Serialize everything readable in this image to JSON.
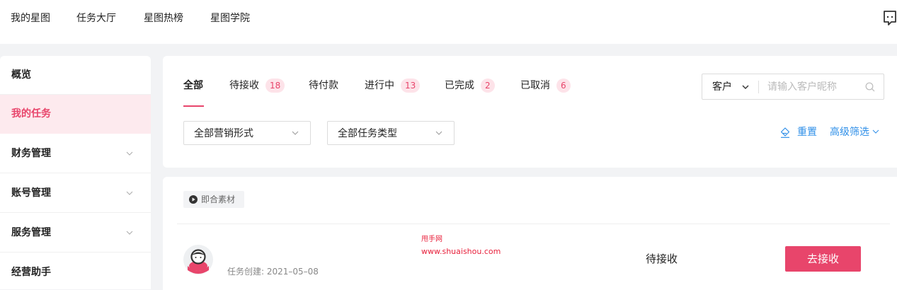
{
  "topnav": {
    "items": [
      {
        "label": "我的星图"
      },
      {
        "label": "任务大厅"
      },
      {
        "label": "星图热榜"
      },
      {
        "label": "星图学院"
      }
    ],
    "message_icon": "message-icon"
  },
  "sidebar": {
    "items": [
      {
        "label": "概览",
        "active": false,
        "expandable": false
      },
      {
        "label": "我的任务",
        "active": true,
        "expandable": false
      },
      {
        "label": "财务管理",
        "active": false,
        "expandable": true
      },
      {
        "label": "账号管理",
        "active": false,
        "expandable": true
      },
      {
        "label": "服务管理",
        "active": false,
        "expandable": true
      },
      {
        "label": "经营助手",
        "active": false,
        "expandable": false
      }
    ]
  },
  "tabs": [
    {
      "label": "全部",
      "count": "",
      "active": true
    },
    {
      "label": "待接收",
      "count": "18",
      "active": false
    },
    {
      "label": "待付款",
      "count": "",
      "active": false
    },
    {
      "label": "进行中",
      "count": "13",
      "active": false
    },
    {
      "label": "已完成",
      "count": "2",
      "active": false
    },
    {
      "label": "已取消",
      "count": "6",
      "active": false
    }
  ],
  "filters": {
    "marketing_form": "全部营销形式",
    "task_type": "全部任务类型"
  },
  "search": {
    "scope_label": "客户",
    "placeholder": "请输入客户昵称",
    "value": ""
  },
  "actions": {
    "reset": "重置",
    "advanced_filter": "高级筛选"
  },
  "task": {
    "tag": "即合素材",
    "created": "任务创建:  2021–05–08",
    "status": "待接收",
    "accept_button": "去接收"
  },
  "watermark": {
    "line1": "甩手网",
    "line2": "www.shuaishou.com"
  },
  "colors": {
    "accent": "#e8456b",
    "link": "#2f8fe8",
    "active_bg": "#fdeaee",
    "badge_bg": "#fde3e9",
    "page_bg": "#f2f3f5"
  }
}
